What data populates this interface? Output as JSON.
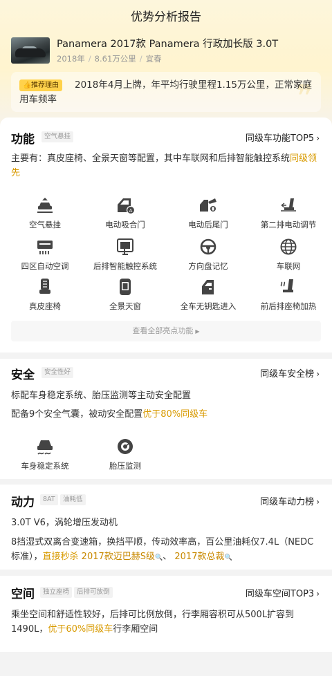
{
  "header": {
    "title": "优势分析报告"
  },
  "car": {
    "name": "Panamera 2017款 Panamera 行政加长版 3.0T",
    "year": "2018年",
    "mileage": "8.61万公里",
    "city": "宜春",
    "separator": "/"
  },
  "reason": {
    "badge": "推荐理由",
    "text": "2018年4月上牌，年平均行驶里程1.15万公里，正常家庭用车频率"
  },
  "features": {
    "title": "功能",
    "tag": "空气悬挂",
    "rank_link": "同级车功能TOP5",
    "summary_prefix": "主要有：真皮座椅、全景天窗等配置，其中车联网和后排智能触控系统",
    "summary_highlight": "同级领先",
    "items": [
      {
        "label": "空气悬挂",
        "icon": "air-suspension-icon"
      },
      {
        "label": "电动吸合门",
        "icon": "soft-close-door-icon"
      },
      {
        "label": "电动后尾门",
        "icon": "power-tailgate-icon"
      },
      {
        "label": "第二排电动调节",
        "icon": "seat-adjust-icon"
      },
      {
        "label": "四区自动空调",
        "icon": "climate-control-icon"
      },
      {
        "label": "后排智能触控系统",
        "icon": "touch-control-icon"
      },
      {
        "label": "方向盘记忆",
        "icon": "steering-wheel-icon"
      },
      {
        "label": "车联网",
        "icon": "connected-car-icon"
      },
      {
        "label": "真皮座椅",
        "icon": "leather-seat-icon"
      },
      {
        "label": "全景天窗",
        "icon": "panoramic-sunroof-icon"
      },
      {
        "label": "全车无钥匙进入",
        "icon": "keyless-entry-icon"
      },
      {
        "label": "前后排座椅加热",
        "icon": "seat-heating-icon"
      }
    ],
    "more_button": "查看全部亮点功能"
  },
  "safety": {
    "title": "安全",
    "tag": "安全性好",
    "rank_link": "同级车安全榜",
    "line1": "标配车身稳定系统、胎压监测等主动安全配置",
    "line2_prefix": "配备9个安全气囊，被动安全配置",
    "line2_highlight": "优于80%同级车",
    "items": [
      {
        "label": "车身稳定系统",
        "icon": "stability-control-icon"
      },
      {
        "label": "胎压监测",
        "icon": "tire-pressure-icon"
      }
    ]
  },
  "power": {
    "title": "动力",
    "tags": [
      "8AT",
      "油耗低"
    ],
    "rank_link": "同级车动力榜",
    "line1": "3.0T V6，涡轮增压发动机",
    "line2_prefix": "8挡湿式双离合变速箱，换挡平顺，传动效率高，百公里油耗仅7.4L（NEDC标准），",
    "line2_highlight": "直接秒杀",
    "compare1": "2017款迈巴赫S级",
    "compare_sep": "、",
    "compare2": "2017款总裁"
  },
  "space": {
    "title": "空间",
    "tags": [
      "独立座椅",
      "后排可放倒"
    ],
    "rank_link": "同级车空间TOP3",
    "text_prefix": "乘坐空间和舒适性较好，后排可比例放倒，行李厢容积可从500L扩容到1490L，",
    "text_highlight": "优于60%同级车",
    "text_suffix": "行李厢空间"
  },
  "colors": {
    "accent": "#d89a00",
    "badge": "#ffd24b",
    "icon": "#444444"
  }
}
